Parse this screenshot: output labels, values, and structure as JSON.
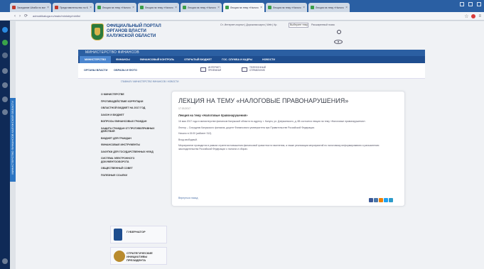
{
  "browser": {
    "tabs": [
      {
        "title": "Заседание Штаба по вопросам",
        "fav": "r",
        "active": false
      },
      {
        "title": "Представительство по Калужской",
        "fav": "r",
        "active": false
      },
      {
        "title": "Лекция на тему «Налоговые",
        "fav": "g",
        "active": false
      },
      {
        "title": "Лекция на тему «Налоговые",
        "fav": "g",
        "active": false
      },
      {
        "title": "Лекция на тему «Налоговые",
        "fav": "g",
        "active": false
      },
      {
        "title": "Лекция на тему «Налоговые",
        "fav": "g",
        "active": true
      },
      {
        "title": "Лекция на тему «Налоговые",
        "fav": "g",
        "active": false
      },
      {
        "title": "Лекция на тему «Налоговые",
        "fav": "g",
        "active": false
      }
    ],
    "url": "admoblkaluga.ru/main/ministry/minfin/"
  },
  "os": {
    "side_tab_label": "МИНИСТЕРСТВО ФИНАНСОВ КАЛУЖСКОЙ ОБЛАСТИ"
  },
  "header": {
    "logo_line1": "ОФИЦИАЛЬНЫЙ ПОРТАЛ",
    "logo_line2": "ОРГАНОВ ВЛАСТИ",
    "logo_line3": "КАЛУЖСКОЙ ОБЛАСТИ",
    "top_links": "Ст. Интернет-портал | Дорожная карта | Web | Кр.",
    "search_value": "Выберите тему",
    "search_label": "Расширенный поиск"
  },
  "ministry_bar": "МИНИСТЕРСТВО ФИНАНСОВ",
  "main_nav": [
    {
      "label": "МИНИСТЕРСТВО",
      "active": true
    },
    {
      "label": "ФИНАНСЫ",
      "active": false
    },
    {
      "label": "ФИНАНСОВЫЙ КОНТРОЛЬ",
      "active": false
    },
    {
      "label": "ОТКРЫТЫЙ БЮДЖЕТ",
      "active": false
    },
    {
      "label": "ГОС. СЛУЖБА И КАДРЫ",
      "active": false
    },
    {
      "label": "НОВОСТИ",
      "active": false
    }
  ],
  "sub_nav": {
    "link1": "ОРГАНЫ ВЛАСТИ",
    "link2": "ОБРАЗЫ И ФОТО",
    "item1": "ИНТЕРНЕТ-ПРИЕМНАЯ",
    "item2": "ТЕЛЕФОННЫЙ СПРАВОЧНИК"
  },
  "breadcrumb": "ГЛАВНАЯ / МИНИСТЕРСТВО ФИНАНСОВ / НОВОСТИ",
  "left_menu": [
    "О МИНИСТЕРСТВЕ",
    "ПРОТИВОДЕЙСТВИЕ КОРРУПЦИИ",
    "ОБЛАСТНОЙ БЮДЖЕТ НА 2017 ГОД",
    "ЗАКОН И БЮДЖЕТ",
    "ВОПРОСЫ ФИНАНСОВЫХ ГРАЖДАН",
    "ЗАЩИТА ГРАЖДАН ОТ ПРОТИВОПРАВНЫХ ДЕЙСТВИЙ",
    "БЮДЖЕТ ДЛЯ ГРАЖДАН",
    "ФИНАНСОВЫЕ ИНСТРУМЕНТЫ",
    "ЗАКУПКИ ДЛЯ ГОСУДАРСТВЕННЫХ НУЖД",
    "СИСТЕМА ЭЛЕКТРОННОГО ДОКУМЕНТООБОРОТА",
    "ОБЩЕСТВЕННЫЙ СОВЕТ",
    "ПОЛЕЗНЫЕ ССЫЛКИ"
  ],
  "promos": [
    {
      "title": "ГУБЕРНАТОР"
    },
    {
      "title": "СТРАТЕГИЧЕСКИЕ ИНИЦИАТИВЫ ПРЕЗИДЕНТА"
    }
  ],
  "article": {
    "title": "ЛЕКЦИЯ НА ТЕМУ «НАЛОГОВЫЕ ПРАВОНАРУШЕНИЯ»",
    "date": "17.03.2017",
    "subtitle": "Лекция на тему «Налоговые правонарушения»",
    "para1": "16 мая 2017 года в министерстве финансов Калужской области по адресу: г. Калуга, ул. Дзержинского, д. 88 состоится лекция на тему «Налоговые правонарушения».",
    "para2": "Лектор – Сотрудник Калужского филиала, доцент Финансового университета при Правительстве Российской Федерации.",
    "para3": "Начало в 15:00 (кабинет 312).",
    "para4": "Вход свободный.",
    "para5": "Мероприятие проводится в рамках стратегии повышения финансовой грамотности населения, а также реализации мероприятий по налоговому информированию и разъяснению законодательства Российской Федерации о налогах и сборах.",
    "back_link": "Вернуться назад"
  },
  "share_colors": [
    "#3b5998",
    "#4a76a8",
    "#ee8208",
    "#1da1f2",
    "#2c9bc9"
  ]
}
